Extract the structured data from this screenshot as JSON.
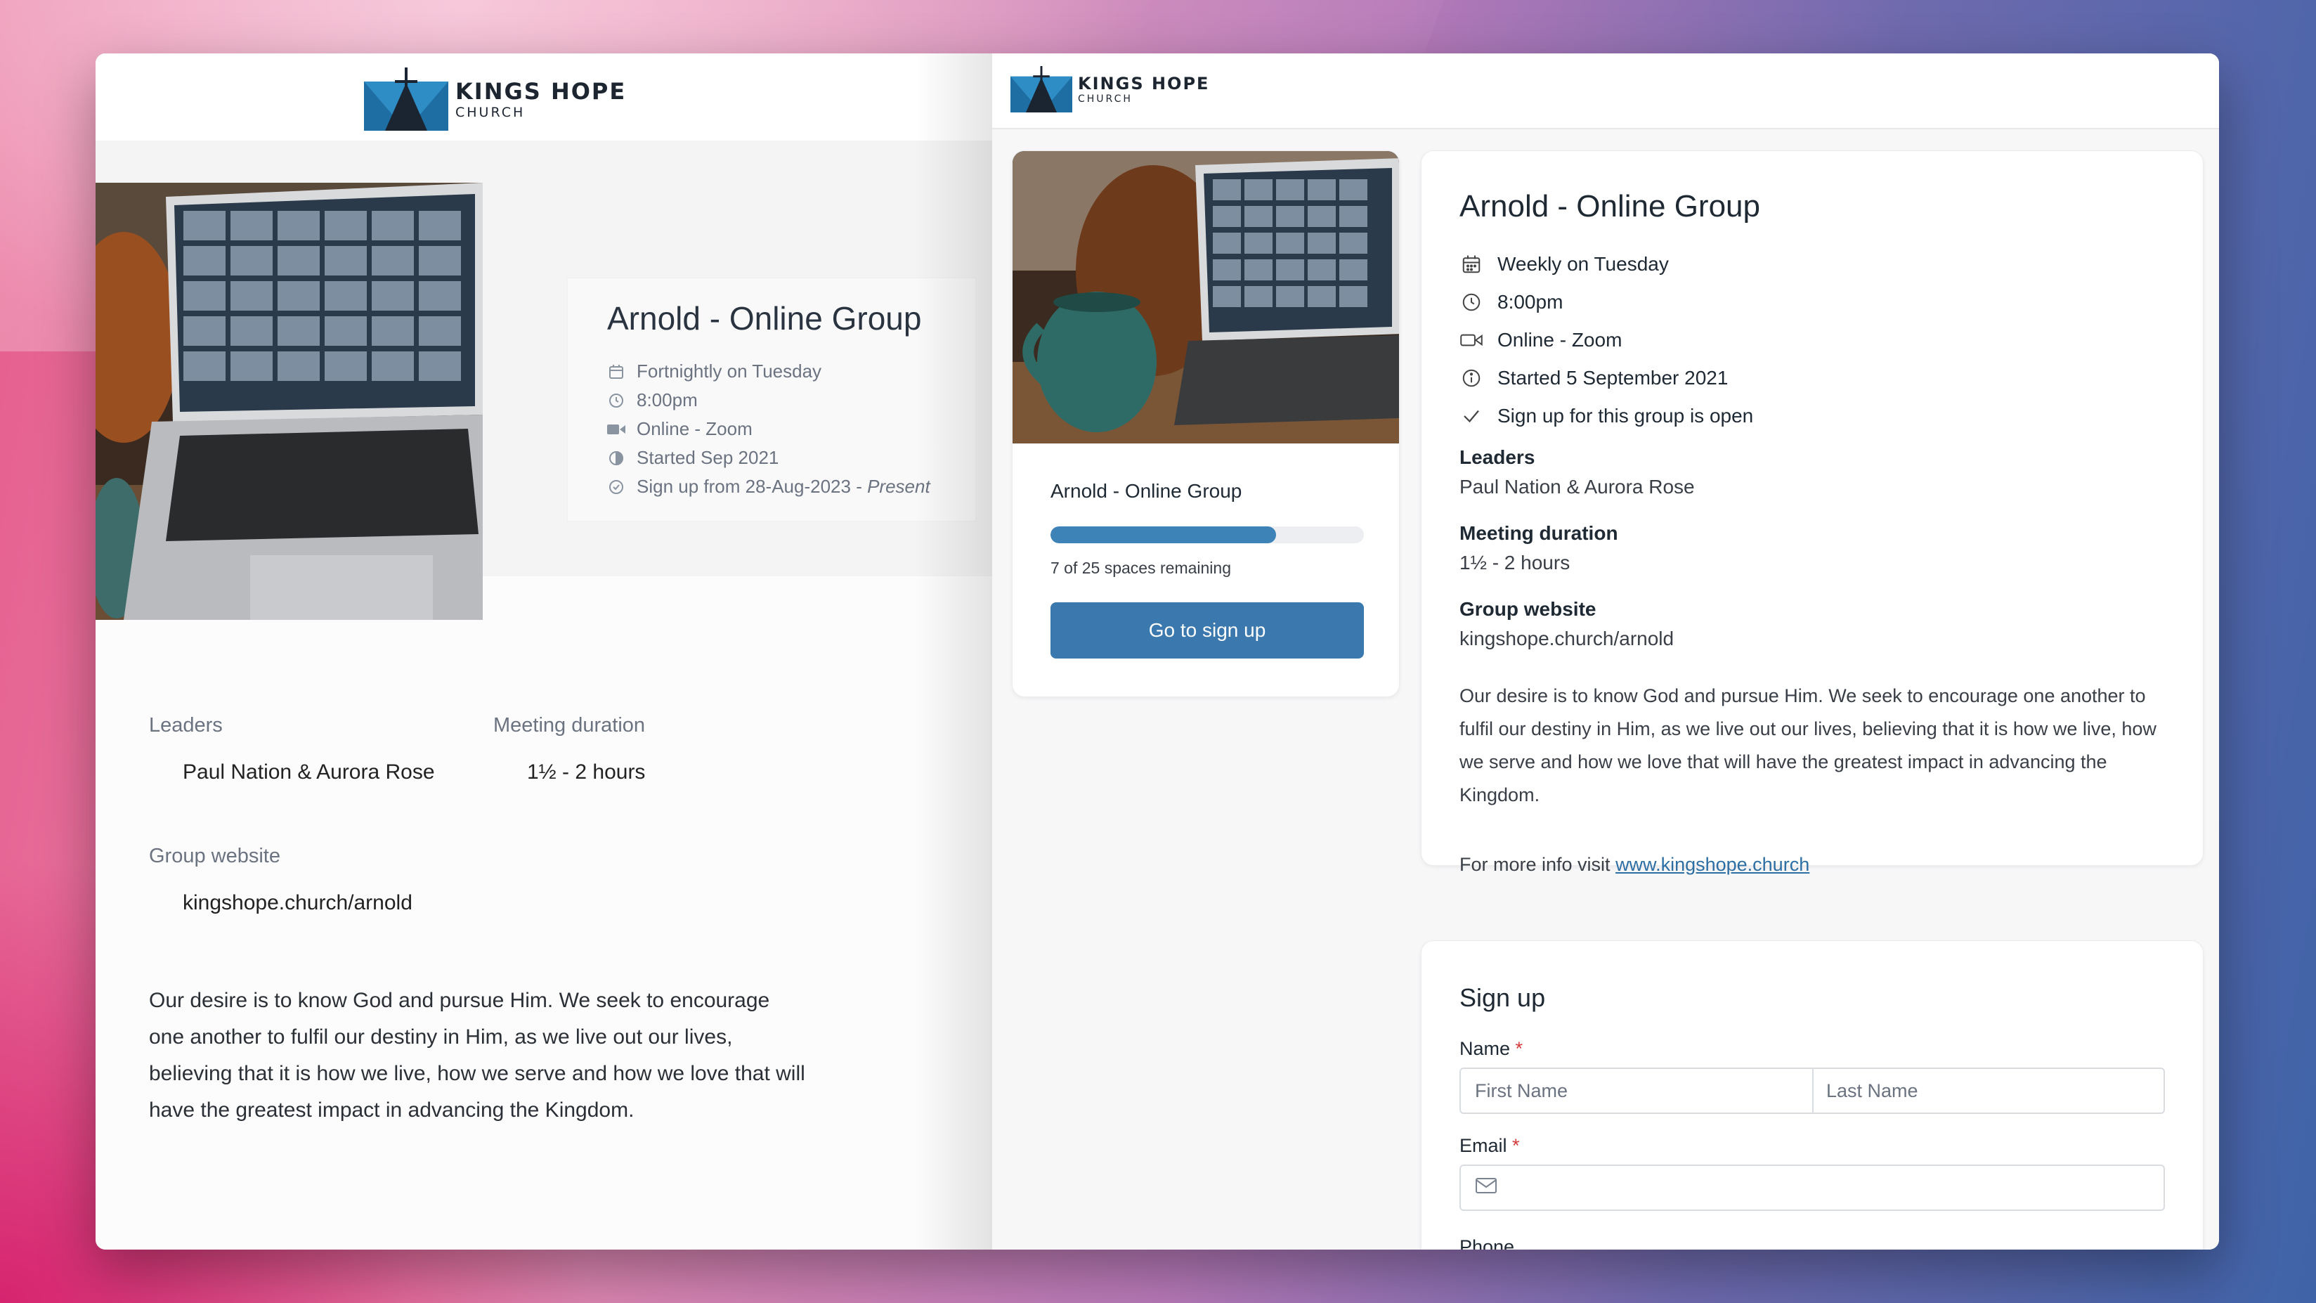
{
  "old_page": {
    "logo": {
      "line1": "KINGS HOPE",
      "line2": "CHURCH"
    },
    "title": "Arnold - Online Group",
    "meta": [
      {
        "icon": "calendar-icon",
        "text": "Fortnightly on Tuesday"
      },
      {
        "icon": "clock-icon",
        "text": "8:00pm"
      },
      {
        "icon": "video-icon",
        "text": "Online - Zoom"
      },
      {
        "icon": "start-icon",
        "text": "Started Sep 2021"
      },
      {
        "icon": "check-circle-icon",
        "text": "Sign up from 28-Aug-2023 - ",
        "emphasis": "Present"
      }
    ],
    "leaders_label": "Leaders",
    "leaders_value": "Paul Nation & Aurora Rose",
    "duration_label": "Meeting duration",
    "duration_value": "1½ - 2 hours",
    "website_label": "Group website",
    "website_value": "kingshope.church/arnold",
    "description": "Our desire is to know God and pursue Him. We seek to encourage one another to fulfil our destiny in Him, as we live out our lives, believing that it is how we live, how we serve and how we love that will have the greatest impact in advancing the Kingdom."
  },
  "new_page": {
    "logo": {
      "line1": "KINGS HOPE",
      "line2": "CHURCH"
    },
    "summary": {
      "title": "Arnold - Online Group",
      "spaces_text": "7 of 25 spaces remaining",
      "progress_fraction": 0.72,
      "button_label": "Go to sign up"
    },
    "details": {
      "title": "Arnold - Online Group",
      "meta": [
        {
          "icon": "calendar-icon",
          "text": "Weekly on Tuesday"
        },
        {
          "icon": "clock-icon",
          "text": "8:00pm"
        },
        {
          "icon": "video-icon",
          "text": "Online - Zoom"
        },
        {
          "icon": "info-icon",
          "text": "Started 5 September 2021"
        },
        {
          "icon": "check-icon",
          "text": "Sign up for this group is open"
        }
      ],
      "leaders_label": "Leaders",
      "leaders_value": "Paul Nation & Aurora Rose",
      "duration_label": "Meeting duration",
      "duration_value": "1½ - 2 hours",
      "website_label": "Group website",
      "website_value": "kingshope.church/arnold",
      "description": "Our desire is to know God and pursue Him. We seek to encourage one another to fulfil our destiny in Him, as we live out our lives, believing that it is how we live, how we serve and how we love that will have the greatest impact in advancing the Kingdom.",
      "more_prefix": "For more info visit ",
      "more_link": "www.kingshope.church"
    },
    "signup": {
      "title": "Sign up",
      "name_label": "Name",
      "required_mark": "*",
      "first_placeholder": "First Name",
      "last_placeholder": "Last Name",
      "email_label": "Email",
      "phone_label": "Phone"
    }
  }
}
